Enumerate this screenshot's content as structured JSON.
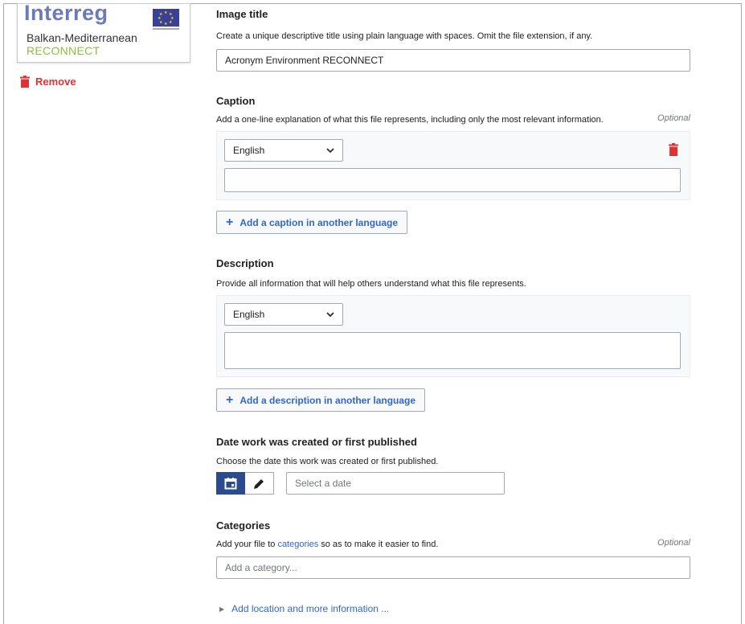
{
  "thumbnail": {
    "brand": "Interreg",
    "subtitle": "Balkan-Mediterranean",
    "program": "RECONNECT"
  },
  "remove_label": "Remove",
  "image_title": {
    "label": "Image title",
    "help": "Create a unique descriptive title using plain language with spaces. Omit the file extension, if any.",
    "value": "Acronym Environment RECONNECT"
  },
  "caption": {
    "label": "Caption",
    "help": "Add a one-line explanation of what this file represents, including only the most relevant information.",
    "optional": "Optional",
    "language": "English",
    "value": "",
    "add_button": "Add a caption in another language"
  },
  "description": {
    "label": "Description",
    "help": "Provide all information that will help others understand what this file represents.",
    "language": "English",
    "value": "",
    "add_button": "Add a description in another language"
  },
  "date": {
    "label": "Date work was created or first published",
    "help": "Choose the date this work was created or first published.",
    "placeholder": "Select a date",
    "icons": [
      "calendar-icon",
      "pencil-icon"
    ]
  },
  "categories": {
    "label": "Categories",
    "help_before": "Add your file to ",
    "help_link": "categories",
    "help_after": " so as to make it easier to find.",
    "optional": "Optional",
    "placeholder": "Add a category..."
  },
  "more_info": "Add location and more information ...",
  "colors": {
    "accent": "#3366cc",
    "destructive": "#d33333",
    "progressive_active": "#2a4b8d"
  }
}
